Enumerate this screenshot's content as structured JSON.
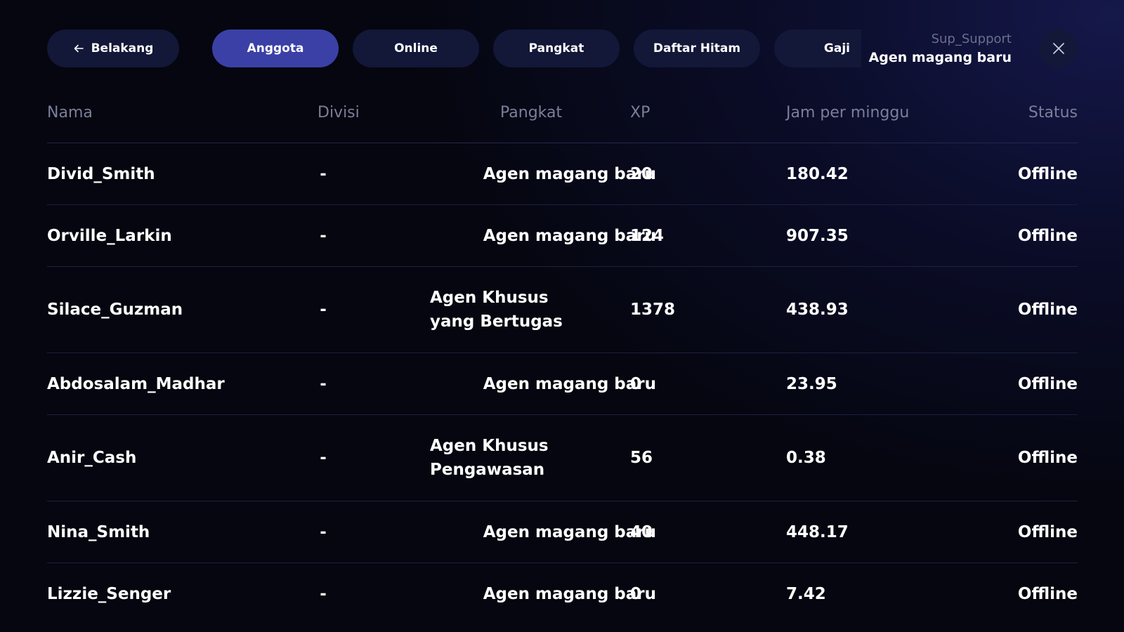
{
  "nav": {
    "back_label": "Belakang",
    "tabs": [
      {
        "label": "Anggota",
        "active": true
      },
      {
        "label": "Online",
        "active": false
      },
      {
        "label": "Pangkat",
        "active": false
      },
      {
        "label": "Daftar Hitam",
        "active": false
      },
      {
        "label": "Gaji",
        "active": false
      }
    ]
  },
  "profile": {
    "username": "Sup_Support",
    "rank": "Agen magang baru"
  },
  "icons": {
    "back": "arrow-left-icon",
    "close": "close-icon"
  },
  "colors": {
    "active_tab": "#3b40a6",
    "pill_bg": "#131738",
    "header_text": "#7b7f99"
  },
  "table": {
    "columns": [
      "Nama",
      "Divisi",
      "Pangkat",
      "XP",
      "Jam per minggu",
      "Status"
    ],
    "rows": [
      {
        "name": "Divid_Smith",
        "division": "-",
        "rank": "Agen magang baru",
        "xp": "20",
        "hours": "180.42",
        "status": "Offline"
      },
      {
        "name": "Orville_Larkin",
        "division": "-",
        "rank": "Agen magang baru",
        "xp": "124",
        "hours": "907.35",
        "status": "Offline"
      },
      {
        "name": "Silace_Guzman",
        "division": "-",
        "rank": "Agen Khusus yang Bertugas",
        "xp": "1378",
        "hours": "438.93",
        "status": "Offline"
      },
      {
        "name": "Abdosalam_Madhar",
        "division": "-",
        "rank": "Agen magang baru",
        "xp": "0",
        "hours": "23.95",
        "status": "Offline"
      },
      {
        "name": "Anir_Cash",
        "division": "-",
        "rank": "Agen Khusus Pengawasan",
        "xp": "56",
        "hours": "0.38",
        "status": "Offline"
      },
      {
        "name": "Nina_Smith",
        "division": "-",
        "rank": "Agen magang baru",
        "xp": "40",
        "hours": "448.17",
        "status": "Offline"
      },
      {
        "name": "Lizzie_Senger",
        "division": "-",
        "rank": "Agen magang baru",
        "xp": "0",
        "hours": "7.42",
        "status": "Offline"
      }
    ]
  }
}
